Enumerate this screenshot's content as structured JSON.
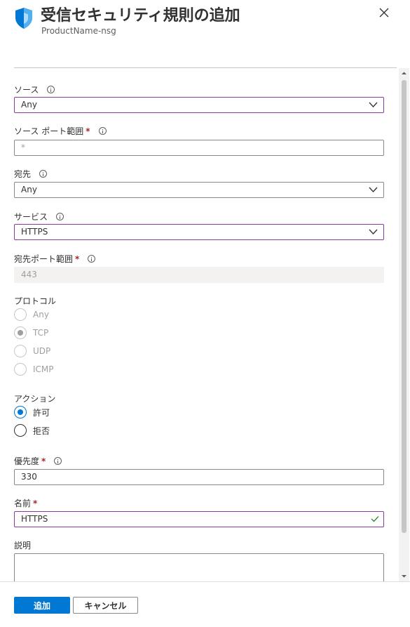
{
  "header": {
    "title": "受信セキュリティ規則の追加",
    "subtitle": "ProductName-nsg",
    "icon": "shield-icon",
    "close_icon": "close-icon"
  },
  "form": {
    "source": {
      "label": "ソース",
      "value": "Any"
    },
    "source_port": {
      "label": "ソース ポート範囲",
      "required": "*",
      "placeholder": "*"
    },
    "destination": {
      "label": "宛先",
      "value": "Any"
    },
    "service": {
      "label": "サービス",
      "value": "HTTPS"
    },
    "dest_port": {
      "label": "宛先ポート範囲",
      "required": "*",
      "value": "443"
    },
    "protocol": {
      "label": "プロトコル",
      "options": [
        "Any",
        "TCP",
        "UDP",
        "ICMP"
      ],
      "selected": "TCP"
    },
    "action": {
      "label": "アクション",
      "options": [
        "許可",
        "拒否"
      ],
      "selected": "許可"
    },
    "priority": {
      "label": "優先度",
      "required": "*",
      "value": "330"
    },
    "name": {
      "label": "名前",
      "required": "*",
      "value": "HTTPS"
    },
    "description": {
      "label": "説明",
      "value": ""
    }
  },
  "footer": {
    "add_label": "追加",
    "cancel_label": "キャンセル"
  },
  "colors": {
    "accent": "#0078d4",
    "focus_border": "#8a3a9e",
    "required": "#a4262c",
    "valid_check": "#107c10"
  }
}
